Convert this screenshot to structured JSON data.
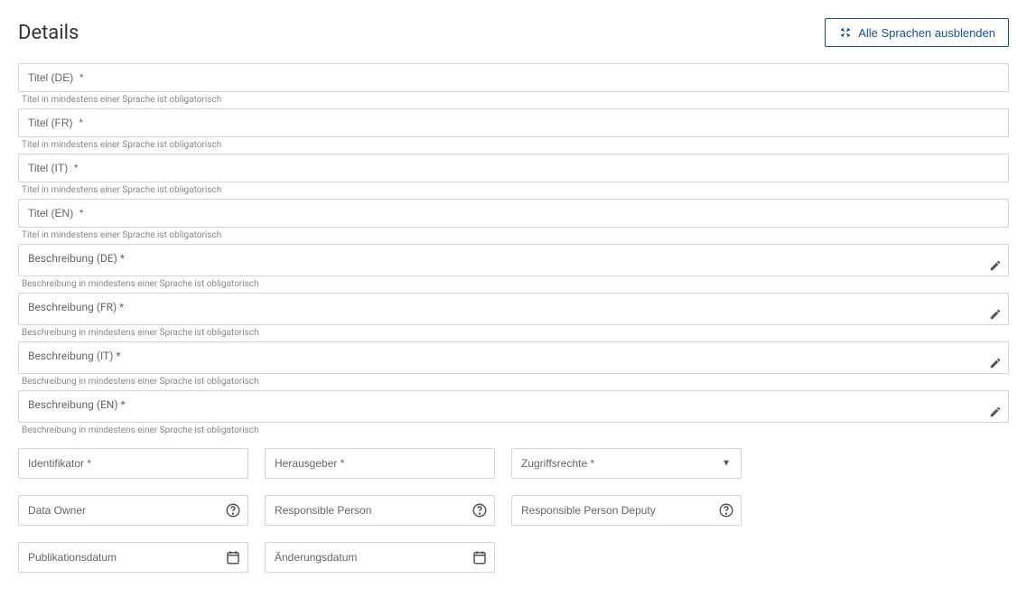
{
  "header": {
    "title": "Details",
    "collapse_languages_label": "Alle Sprachen ausblenden"
  },
  "title_fields": {
    "de": {
      "placeholder": "Titel (DE)  *",
      "hint": "Titel in mindestens einer Sprache ist obligatorisch"
    },
    "fr": {
      "placeholder": "Titel (FR)  *",
      "hint": "Titel in mindestens einer Sprache ist obligatorisch"
    },
    "it": {
      "placeholder": "Titel (IT)  *",
      "hint": "Titel in mindestens einer Sprache ist obligatorisch"
    },
    "en": {
      "placeholder": "Titel (EN)  *",
      "hint": "Titel in mindestens einer Sprache ist obligatorisch"
    }
  },
  "description_fields": {
    "de": {
      "placeholder": "Beschreibung (DE)  *",
      "hint": "Beschreibung in mindestens einer Sprache ist obligatorisch"
    },
    "fr": {
      "placeholder": "Beschreibung (FR)  *",
      "hint": "Beschreibung in mindestens einer Sprache ist obligatorisch"
    },
    "it": {
      "placeholder": "Beschreibung (IT)  *",
      "hint": "Beschreibung in mindestens einer Sprache ist obligatorisch"
    },
    "en": {
      "placeholder": "Beschreibung (EN)  *",
      "hint": "Beschreibung in mindestens einer Sprache ist obligatorisch"
    }
  },
  "row1": {
    "identifier": {
      "placeholder": "Identifikator *"
    },
    "publisher": {
      "placeholder": "Herausgeber *"
    },
    "access_rights": {
      "placeholder": "Zugriffsrechte *"
    }
  },
  "row2": {
    "data_owner": {
      "placeholder": "Data Owner"
    },
    "responsible_person": {
      "placeholder": "Responsible Person"
    },
    "responsible_person_deputy": {
      "placeholder": "Responsible Person Deputy"
    }
  },
  "row3": {
    "publication_date": {
      "placeholder": "Publikationsdatum"
    },
    "modification_date": {
      "placeholder": "Änderungsdatum"
    }
  }
}
